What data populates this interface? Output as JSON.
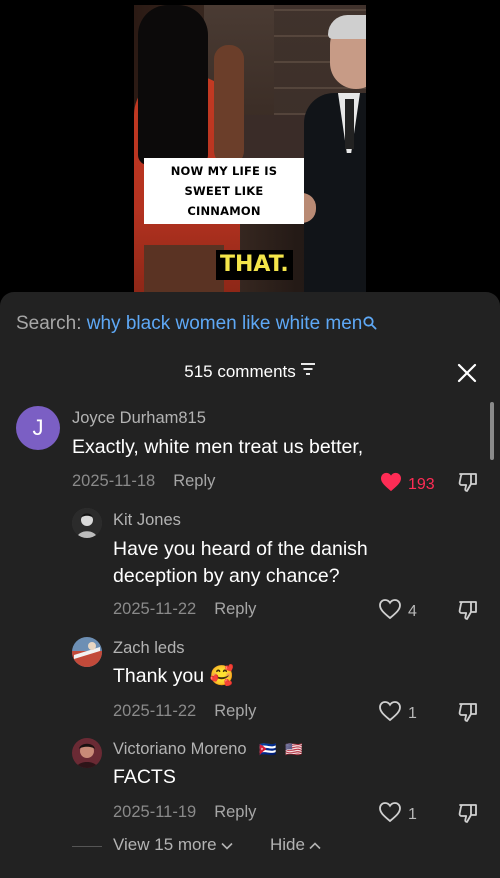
{
  "video": {
    "caption_lines": [
      "NOW MY LIFE IS SWEET LIKE",
      "CINNAMON"
    ],
    "subtitle_word": "THAT."
  },
  "search": {
    "label": "Search:",
    "query": "why black women like white men"
  },
  "comments_header": {
    "count_label": "515 comments"
  },
  "comments": [
    {
      "username": "Joyce Durham815",
      "avatar_letter": "J",
      "text": "Exactly, white men treat us better,",
      "date": "2025-11-18",
      "reply_label": "Reply",
      "likes": "193",
      "liked": true
    }
  ],
  "replies": [
    {
      "username": "Kit Jones",
      "text_lines": [
        "Have you heard of the danish",
        "deception by any chance?"
      ],
      "date": "2025-11-22",
      "reply_label": "Reply",
      "likes": "4"
    },
    {
      "username": "Zach leds",
      "text": "Thank you",
      "emoji": "🥰",
      "date": "2025-11-22",
      "reply_label": "Reply",
      "likes": "1"
    },
    {
      "username": "Victoriano Moreno",
      "flags": [
        "🇨🇺",
        "🇺🇸"
      ],
      "text": "FACTS",
      "date": "2025-11-19",
      "reply_label": "Reply",
      "likes": "1"
    }
  ],
  "thread_controls": {
    "view_more_label": "View 15 more",
    "hide_label": "Hide"
  },
  "colors": {
    "sheet_bg": "#222222",
    "search_query": "#5ea8f5",
    "like_active": "#fe2c55",
    "avatar_j": "#7b5fc4",
    "caption_word": "#f4e54a"
  },
  "icons": [
    "search-icon",
    "filter-icon",
    "close-icon",
    "heart-icon",
    "dislike-icon",
    "chevron-down-icon",
    "chevron-up-icon"
  ]
}
